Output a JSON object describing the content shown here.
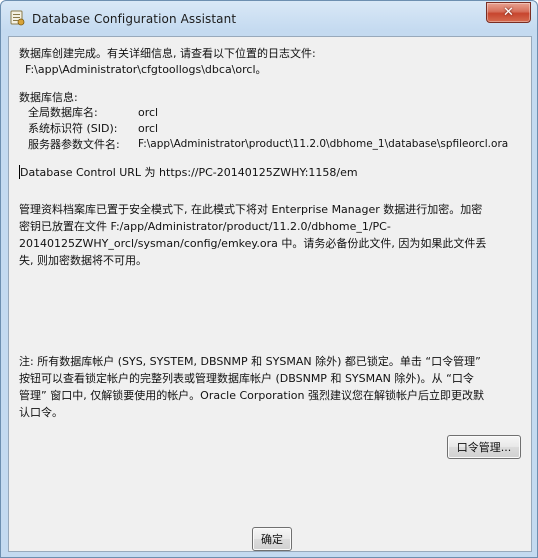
{
  "window": {
    "title": "Database Configuration Assistant",
    "close_glyph": "✕"
  },
  "message": {
    "created_line": "数据库创建完成。有关详细信息, 请查看以下位置的日志文件:",
    "log_path": "F:\\app\\Administrator\\cfgtoollogs\\dbca\\orcl。",
    "info_header": "数据库信息:",
    "info_rows": [
      {
        "label": "全局数据库名:",
        "value": "orcl"
      },
      {
        "label": "系统标识符 (SID):",
        "value": "orcl"
      },
      {
        "label": "服务器参数文件名:",
        "value": "F:\\app\\Administrator\\product\\11.2.0\\dbhome_1\\database\\spfileorcl.ora"
      }
    ],
    "control_url": "Database Control URL 为 https://PC-20140125ZWHY:1158/em",
    "encryption_lines": [
      "管理资料档案库已置于安全模式下, 在此模式下将对 Enterprise Manager 数据进行加密。加密",
      "密钥已放置在文件 F:/app/Administrator/product/11.2.0/dbhome_1/PC-",
      "20140125ZWHY_orcl/sysman/config/emkey.ora 中。请务必备份此文件, 因为如果此文件丢",
      "失, 则加密数据将不可用。"
    ],
    "note_lines": [
      "注: 所有数据库帐户 (SYS, SYSTEM, DBSNMP 和 SYSMAN 除外) 都已锁定。单击 “口令管理”",
      "按钮可以查看锁定帐户的完整列表或管理数据库帐户 (DBSNMP 和 SYSMAN 除外)。从 “口令",
      "管理” 窗口中, 仅解锁要使用的帐户。Oracle Corporation 强烈建议您在解锁帐户后立即更改默",
      "认口令。"
    ]
  },
  "buttons": {
    "password_mgmt": "口令管理...",
    "ok": "确定"
  }
}
